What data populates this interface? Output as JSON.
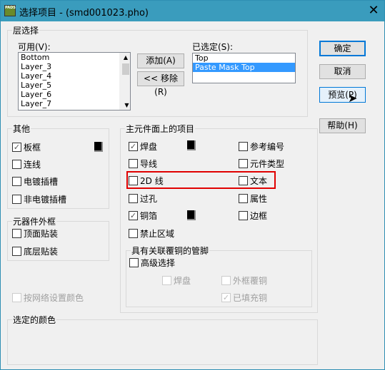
{
  "window": {
    "title": "选择项目 - (smd001023.pho)",
    "icon": "PADS",
    "close": "✕"
  },
  "layer": {
    "legend": "层选择",
    "available_label": "可用(V):",
    "available": [
      "Bottom",
      "Layer_3",
      "Layer_4",
      "Layer_5",
      "Layer_6",
      "Layer_7"
    ],
    "selected_label": "已选定(S):",
    "selected": [
      "Top",
      "Paste Mask Top"
    ],
    "add": "添加(A) >>",
    "remove": "<< 移除(R)"
  },
  "buttons": {
    "ok": "确定",
    "cancel": "取消",
    "preview": "预览(P)",
    "help": "帮助(H)"
  },
  "other": {
    "legend": "其他",
    "items": [
      {
        "label": "板框",
        "checked": true
      },
      {
        "label": "连线",
        "checked": false
      },
      {
        "label": "电镀插槽",
        "checked": false
      },
      {
        "label": "非电镀插槽",
        "checked": false
      }
    ]
  },
  "outline": {
    "legend": "元器件外框",
    "items": [
      {
        "label": "顶面贴装",
        "checked": false
      },
      {
        "label": "底层贴装",
        "checked": false
      }
    ]
  },
  "net_color": {
    "label": "按网络设置颜色",
    "checked": false,
    "disabled": true
  },
  "main": {
    "legend": "主元件面上的项目",
    "left": [
      {
        "label": "焊盘",
        "checked": true
      },
      {
        "label": "导线",
        "checked": false
      },
      {
        "label": "2D 线",
        "checked": false
      },
      {
        "label": "过孔",
        "checked": false
      },
      {
        "label": "铜箔",
        "checked": true
      },
      {
        "label": "禁止区域",
        "checked": false
      }
    ],
    "right": [
      {
        "label": "参考编号",
        "checked": false
      },
      {
        "label": "元件类型",
        "checked": false
      },
      {
        "label": "文本",
        "checked": false
      },
      {
        "label": "属性",
        "checked": false
      },
      {
        "label": "边框",
        "checked": false
      }
    ]
  },
  "pins": {
    "legend": "具有关联覆铜的管脚",
    "advanced": {
      "label": "高级选择",
      "checked": false
    },
    "pad": {
      "label": "焊盘",
      "checked": false
    },
    "outline_pour": {
      "label": "外框覆铜",
      "checked": false
    },
    "filled": {
      "label": "已填充铜",
      "checked": true
    }
  },
  "color": {
    "legend": "选定的颜色"
  },
  "colors": {
    "titlebar": "#3a9cbd",
    "highlight": "#3399ff",
    "annotation": "#e00000"
  }
}
